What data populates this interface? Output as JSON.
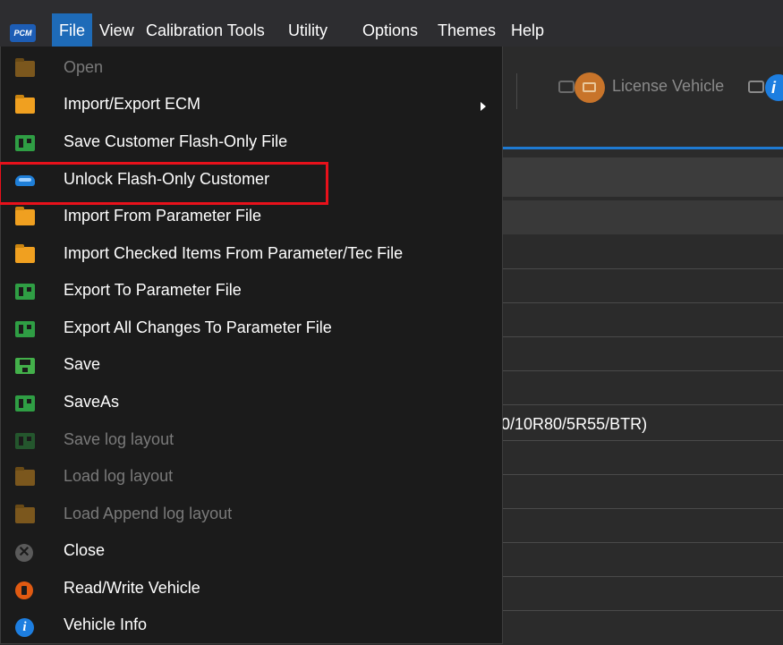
{
  "app": {
    "icon_text": "PCM"
  },
  "menubar": {
    "items": [
      {
        "label": "File",
        "active": true
      },
      {
        "label": "View"
      },
      {
        "label": "Calibration Tools"
      },
      {
        "label": "Utility"
      },
      {
        "label": "Options"
      },
      {
        "label": "Themes"
      },
      {
        "label": "Help"
      }
    ]
  },
  "toolbar": {
    "license_label": "License Vehicle",
    "info_glyph": "i"
  },
  "grid": {
    "visible_cell_text": "0/10R80/5R55/BTR)"
  },
  "file_menu": {
    "items": [
      {
        "label": "Open",
        "icon": "folder-icon",
        "enabled": false
      },
      {
        "label": "Import/Export ECM",
        "icon": "folder-icon",
        "enabled": true,
        "submenu": true
      },
      {
        "label": "Save Customer Flash-Only File",
        "icon": "green-file-icon",
        "enabled": true
      },
      {
        "label": "Unlock Flash-Only Customer",
        "icon": "car-icon",
        "enabled": true,
        "highlighted": true,
        "highlight_color": "#e8111b"
      },
      {
        "label": "Import From Parameter File",
        "icon": "folder-icon",
        "enabled": true
      },
      {
        "label": "Import Checked Items From Parameter/Tec File",
        "icon": "folder-icon",
        "enabled": true
      },
      {
        "label": "Export To Parameter File",
        "icon": "green-file-icon",
        "enabled": true
      },
      {
        "label": "Export All Changes To Parameter File",
        "icon": "green-file-icon",
        "enabled": true
      },
      {
        "label": "Save",
        "icon": "save-disk-icon",
        "enabled": true
      },
      {
        "label": "SaveAs",
        "icon": "green-file-icon",
        "enabled": true
      },
      {
        "label": "Save log layout",
        "icon": "green-file-icon",
        "enabled": false
      },
      {
        "label": "Load log layout",
        "icon": "folder-icon",
        "enabled": false
      },
      {
        "label": "Load Append log layout",
        "icon": "folder-icon",
        "enabled": false
      },
      {
        "label": "Close",
        "icon": "close-icon",
        "enabled": true,
        "glyph": "✕"
      },
      {
        "label": "Read/Write Vehicle",
        "icon": "read-write-vehicle-icon",
        "enabled": true
      },
      {
        "label": "Vehicle Info",
        "icon": "info-icon",
        "enabled": true,
        "glyph": "i"
      }
    ]
  },
  "colors": {
    "menu_active": "#1e6bb8",
    "menu_bg": "#1b1b1b",
    "highlight": "#e8111b",
    "accent": "#1e7ad2"
  }
}
